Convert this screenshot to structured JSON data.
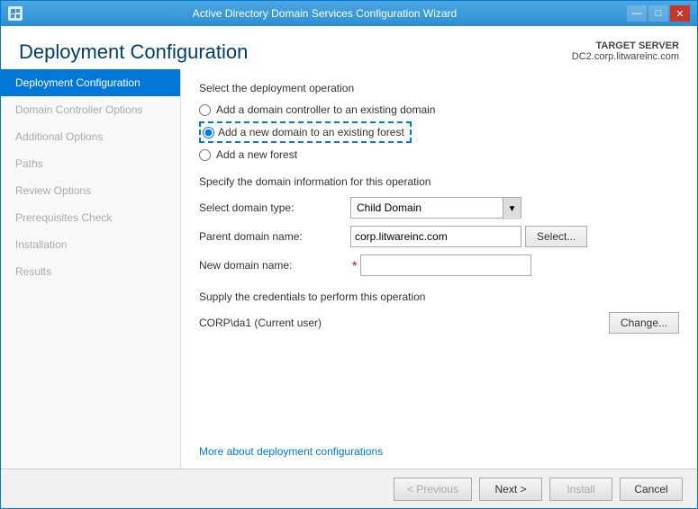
{
  "window": {
    "title": "Active Directory Domain Services Configuration Wizard",
    "icon": "ad-icon"
  },
  "header": {
    "page_title": "Deployment Configuration",
    "target_server_label": "TARGET SERVER",
    "target_server_name": "DC2.corp.litwareinc.com"
  },
  "sidebar": {
    "items": [
      {
        "label": "Deployment Configuration",
        "state": "active"
      },
      {
        "label": "Domain Controller Options",
        "state": "disabled"
      },
      {
        "label": "Additional Options",
        "state": "disabled"
      },
      {
        "label": "Paths",
        "state": "disabled"
      },
      {
        "label": "Review Options",
        "state": "disabled"
      },
      {
        "label": "Prerequisites Check",
        "state": "disabled"
      },
      {
        "label": "Installation",
        "state": "disabled"
      },
      {
        "label": "Results",
        "state": "disabled"
      }
    ]
  },
  "content": {
    "deployment_section_title": "Select the deployment operation",
    "radio_options": [
      {
        "label": "Add a domain controller to an existing domain",
        "selected": false
      },
      {
        "label": "Add a new domain to an existing forest",
        "selected": true
      },
      {
        "label": "Add a new forest",
        "selected": false
      }
    ],
    "domain_info_title": "Specify the domain information for this operation",
    "select_domain_type_label": "Select domain type:",
    "select_domain_type_value": "Child Domain",
    "parent_domain_label": "Parent domain name:",
    "parent_domain_value": "corp.litwareinc.com",
    "parent_domain_select_btn": "Select...",
    "new_domain_label": "New domain name:",
    "new_domain_required_star": "*",
    "credentials_title": "Supply the credentials to perform this operation",
    "credentials_user": "CORP\\da1 (Current user)",
    "change_btn": "Change...",
    "link_text": "More about deployment configurations"
  },
  "footer": {
    "previous_btn": "< Previous",
    "next_btn": "Next >",
    "install_btn": "Install",
    "cancel_btn": "Cancel"
  }
}
